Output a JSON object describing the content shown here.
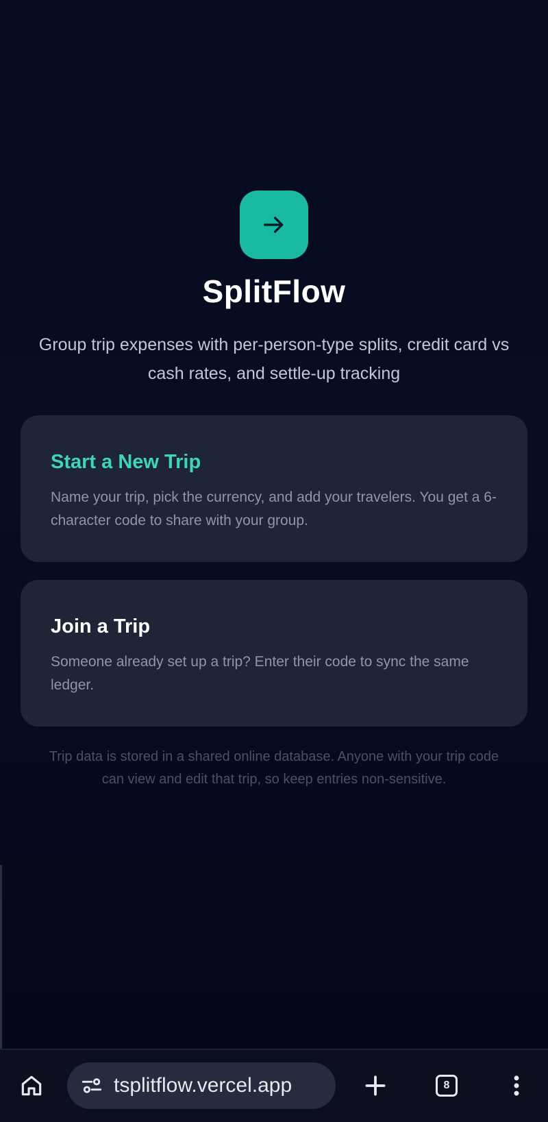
{
  "app": {
    "title": "SplitFlow",
    "subtitle": "Group trip expenses with per-person-type splits, credit card vs cash rates, and settle-up tracking",
    "icon": "arrow-right-icon",
    "accent_color": "#19b9a2"
  },
  "cards": {
    "new_trip": {
      "title": "Start a New Trip",
      "description": "Name your trip, pick the currency, and add your travelers. You get a 6-character code to share with your group."
    },
    "join_trip": {
      "title": "Join a Trip",
      "description": "Someone already set up a trip? Enter their code to sync the same ledger."
    }
  },
  "notice": "Trip data is stored in a shared online database. Anyone with your trip code can view and edit that trip, so keep entries non-sensitive.",
  "browser": {
    "url": "tsplitflow.vercel.app",
    "tab_count": "8",
    "icons": [
      "home-icon",
      "site-settings-icon",
      "plus-icon",
      "tabs-icon",
      "more-vert-icon"
    ]
  }
}
